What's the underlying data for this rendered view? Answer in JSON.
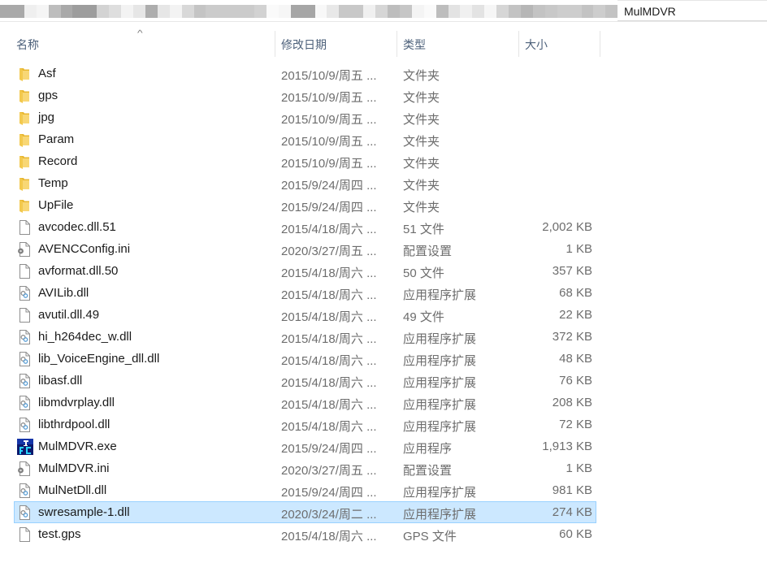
{
  "address_bar": {
    "current_folder": "MulMDVR",
    "obscured_path": true
  },
  "columns": [
    {
      "key": "name",
      "label": "名称",
      "sorted": "ascending"
    },
    {
      "key": "date",
      "label": "修改日期"
    },
    {
      "key": "type",
      "label": "类型"
    },
    {
      "key": "size",
      "label": "大小"
    }
  ],
  "sort_indicator": "^",
  "files": [
    {
      "name": "Asf",
      "date": "2015/10/9/周五 ...",
      "type": "文件夹",
      "size": "",
      "icon": "folder-icon"
    },
    {
      "name": "gps",
      "date": "2015/10/9/周五 ...",
      "type": "文件夹",
      "size": "",
      "icon": "folder-icon"
    },
    {
      "name": "jpg",
      "date": "2015/10/9/周五 ...",
      "type": "文件夹",
      "size": "",
      "icon": "folder-icon"
    },
    {
      "name": "Param",
      "date": "2015/10/9/周五 ...",
      "type": "文件夹",
      "size": "",
      "icon": "folder-icon"
    },
    {
      "name": "Record",
      "date": "2015/10/9/周五 ...",
      "type": "文件夹",
      "size": "",
      "icon": "folder-icon"
    },
    {
      "name": "Temp",
      "date": "2015/9/24/周四 ...",
      "type": "文件夹",
      "size": "",
      "icon": "folder-icon"
    },
    {
      "name": "UpFile",
      "date": "2015/9/24/周四 ...",
      "type": "文件夹",
      "size": "",
      "icon": "folder-icon"
    },
    {
      "name": "avcodec.dll.51",
      "date": "2015/4/18/周六 ...",
      "type": "51 文件",
      "size": "2,002 KB",
      "icon": "blank-file-icon"
    },
    {
      "name": "AVENCConfig.ini",
      "date": "2020/3/27/周五 ...",
      "type": "配置设置",
      "size": "1 KB",
      "icon": "config-file-icon"
    },
    {
      "name": "avformat.dll.50",
      "date": "2015/4/18/周六 ...",
      "type": "50 文件",
      "size": "357 KB",
      "icon": "blank-file-icon"
    },
    {
      "name": "AVILib.dll",
      "date": "2015/4/18/周六 ...",
      "type": "应用程序扩展",
      "size": "68 KB",
      "icon": "dll-file-icon"
    },
    {
      "name": "avutil.dll.49",
      "date": "2015/4/18/周六 ...",
      "type": "49 文件",
      "size": "22 KB",
      "icon": "blank-file-icon"
    },
    {
      "name": "hi_h264dec_w.dll",
      "date": "2015/4/18/周六 ...",
      "type": "应用程序扩展",
      "size": "372 KB",
      "icon": "dll-file-icon"
    },
    {
      "name": "lib_VoiceEngine_dll.dll",
      "date": "2015/4/18/周六 ...",
      "type": "应用程序扩展",
      "size": "48 KB",
      "icon": "dll-file-icon"
    },
    {
      "name": "libasf.dll",
      "date": "2015/4/18/周六 ...",
      "type": "应用程序扩展",
      "size": "76 KB",
      "icon": "dll-file-icon"
    },
    {
      "name": "libmdvrplay.dll",
      "date": "2015/4/18/周六 ...",
      "type": "应用程序扩展",
      "size": "208 KB",
      "icon": "dll-file-icon"
    },
    {
      "name": "libthrdpool.dll",
      "date": "2015/4/18/周六 ...",
      "type": "应用程序扩展",
      "size": "72 KB",
      "icon": "dll-file-icon"
    },
    {
      "name": "MulMDVR.exe",
      "date": "2015/9/24/周四 ...",
      "type": "应用程序",
      "size": "1,913 KB",
      "icon": "exe-app-icon"
    },
    {
      "name": "MulMDVR.ini",
      "date": "2020/3/27/周五 ...",
      "type": "配置设置",
      "size": "1 KB",
      "icon": "config-file-icon"
    },
    {
      "name": "MulNetDll.dll",
      "date": "2015/9/24/周四 ...",
      "type": "应用程序扩展",
      "size": "981 KB",
      "icon": "dll-file-icon"
    },
    {
      "name": "swresample-1.dll",
      "date": "2020/3/24/周二 ...",
      "type": "应用程序扩展",
      "size": "274 KB",
      "icon": "dll-file-icon",
      "selected": true
    },
    {
      "name": "test.gps",
      "date": "2015/4/18/周六 ...",
      "type": "GPS 文件",
      "size": "60 KB",
      "icon": "blank-file-icon"
    }
  ],
  "colors": {
    "selection_bg": "#cce8ff",
    "selection_border": "#99d1ff",
    "header_text": "#4c607a",
    "secondary_text": "#6d6d6d",
    "folder": "#f3c94e"
  }
}
